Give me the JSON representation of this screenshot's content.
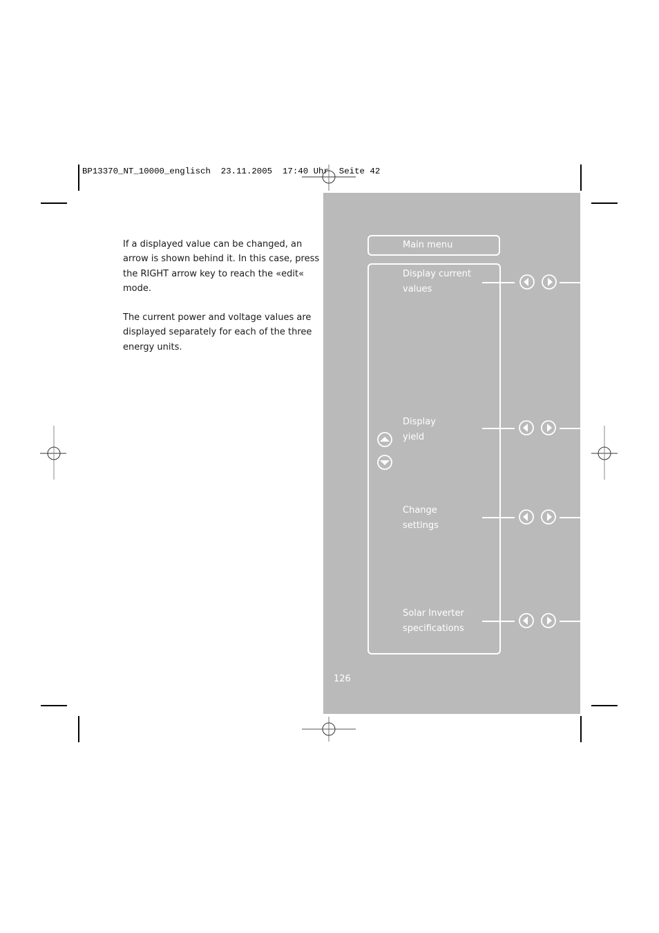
{
  "slug": {
    "text": "BP13370_NT_10000_englisch  23.11.2005  17:40 Uhr  Seite 42"
  },
  "body": {
    "paragraphs": [
      "If a displayed value can be changed, an arrow is shown behind it. In this case, press the RIGHT arrow key to reach the «edit« mode.",
      "The current power and voltage values are displayed separately for each of the three energy units."
    ]
  },
  "panel": {
    "background_color": "#bababa",
    "main_menu_label": "Main menu",
    "menu_items": [
      {
        "line1": "Display current",
        "line2": "values",
        "left_icon": "arrow-left-circle-icon",
        "right_icon": "arrow-right-circle-icon"
      },
      {
        "line1": "Display",
        "line2": "yield",
        "left_icon": "arrow-left-circle-icon",
        "right_icon": "arrow-right-circle-icon"
      },
      {
        "line1": "Change",
        "line2": "settings",
        "left_icon": "arrow-left-circle-icon",
        "right_icon": "arrow-right-circle-icon"
      },
      {
        "line1": "Solar Inverter",
        "line2": "specifications",
        "left_icon": "arrow-left-circle-icon",
        "right_icon": "arrow-right-circle-icon"
      }
    ],
    "nav_icons": [
      "arrow-up-circle-icon",
      "arrow-down-circle-icon"
    ],
    "page_number": "126"
  }
}
